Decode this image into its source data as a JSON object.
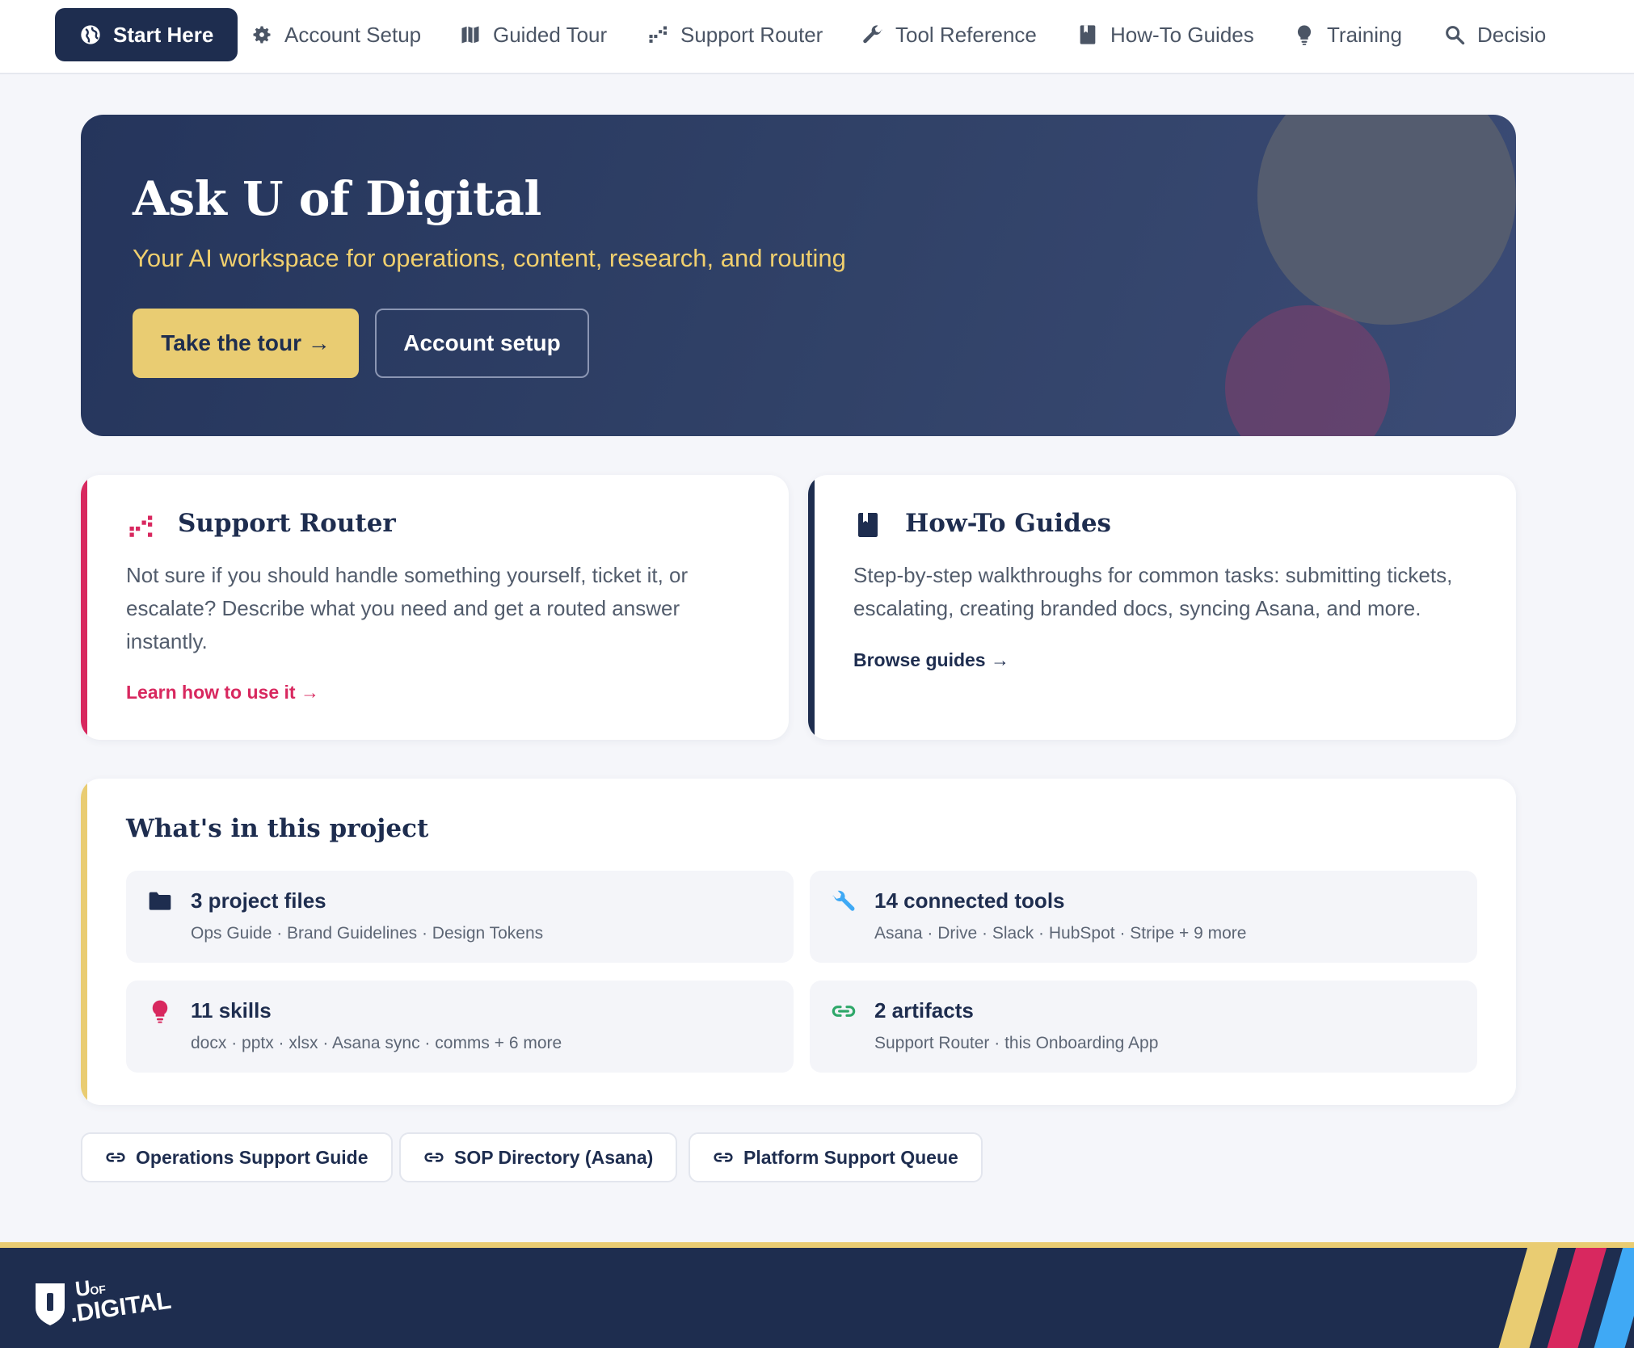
{
  "nav": {
    "items": [
      {
        "label": "Start Here",
        "icon": "globe-icon"
      },
      {
        "label": "Account Setup",
        "icon": "gear-icon"
      },
      {
        "label": "Guided Tour",
        "icon": "map-icon"
      },
      {
        "label": "Support Router",
        "icon": "route-icon"
      },
      {
        "label": "Tool Reference",
        "icon": "wrench-icon"
      },
      {
        "label": "How-To Guides",
        "icon": "book-icon"
      },
      {
        "label": "Training",
        "icon": "lightbulb-icon"
      },
      {
        "label": "Decisio",
        "icon": "search-icon"
      }
    ],
    "active": "Start Here"
  },
  "hero": {
    "title": "Ask U of Digital",
    "subtitle": "Your AI workspace for operations, content, research, and routing",
    "primary_button": "Take the tour →",
    "secondary_button": "Account setup"
  },
  "cards": {
    "router": {
      "title": "Support Router",
      "body": "Not sure if you should handle something yourself, ticket it, or escalate? Describe what you need and get a routed answer instantly.",
      "link": "Learn how to use it →",
      "icon": "route-icon"
    },
    "guides": {
      "title": "How-To Guides",
      "body": "Step-by-step walkthroughs for common tasks: submitting tickets, escalating, creating branded docs, syncing Asana, and more.",
      "link": "Browse guides →",
      "icon": "book-icon"
    }
  },
  "project": {
    "title": "What's in this project",
    "tiles": [
      {
        "title": "3 project files",
        "sub": "Ops Guide · Brand Guidelines · Design Tokens",
        "icon": "folder-icon"
      },
      {
        "title": "14 connected tools",
        "sub": "Asana · Drive · Slack · HubSpot · Stripe + 9 more",
        "icon": "wrench-icon"
      },
      {
        "title": "11 skills",
        "sub": "docx · pptx · xlsx · Asana sync · comms + 6 more",
        "icon": "lightbulb-icon"
      },
      {
        "title": "2 artifacts",
        "sub": "Support Router · this Onboarding App",
        "icon": "link-icon"
      }
    ]
  },
  "links": [
    {
      "label": "Operations Support Guide",
      "icon": "link-icon"
    },
    {
      "label": "SOP Directory (Asana)",
      "icon": "link-icon"
    },
    {
      "label": "Platform Support Queue",
      "icon": "link-icon"
    }
  ],
  "footer": {
    "logo_text_top": "UOF",
    "logo_text_bottom": ".DIGITAL"
  },
  "colors": {
    "navy": "#1e2d4f",
    "gold": "#e9cc72",
    "pink": "#d8285f",
    "blue": "#3fa9f5",
    "green": "#2fa86a",
    "background": "#f5f6fa"
  }
}
